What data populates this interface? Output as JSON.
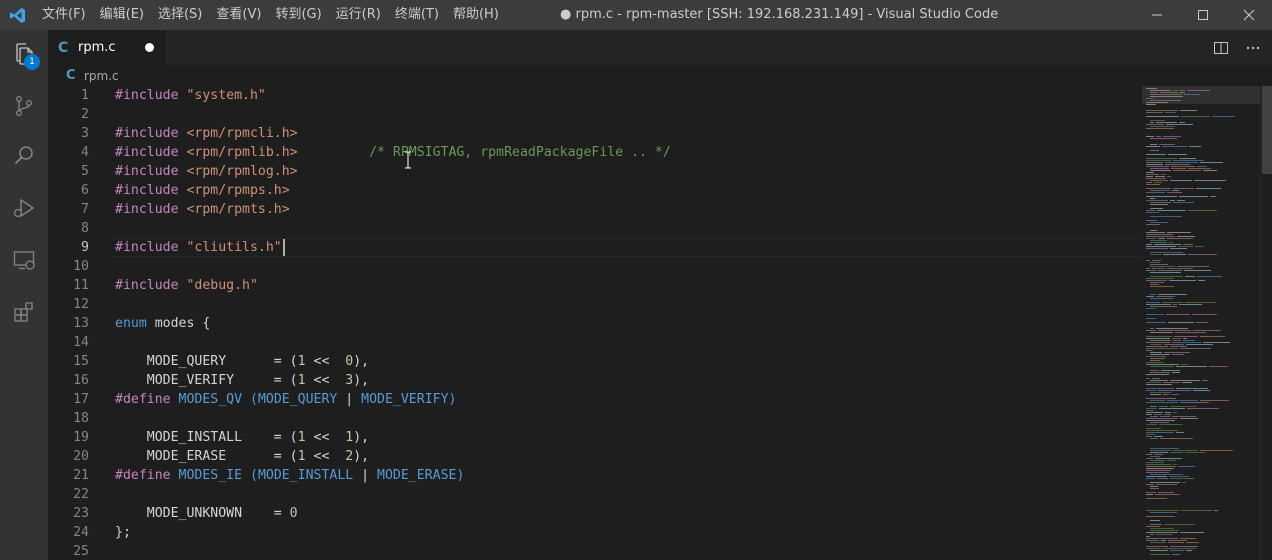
{
  "window": {
    "title": "● rpm.c - rpm-master [SSH: 192.168.231.149] - Visual Studio Code"
  },
  "menu": [
    "文件(F)",
    "编辑(E)",
    "选择(S)",
    "查看(V)",
    "转到(G)",
    "运行(R)",
    "终端(T)",
    "帮助(H)"
  ],
  "activity": {
    "explorer_badge": "1"
  },
  "tab": {
    "icon_text": "C",
    "label": "rpm.c"
  },
  "breadcrumb": {
    "icon_text": "C",
    "label": "rpm.c"
  },
  "editor": {
    "active_line": 9,
    "lines": [
      {
        "n": "1",
        "tokens": [
          [
            "pp",
            "#include "
          ],
          [
            "str",
            "\"system.h\""
          ]
        ]
      },
      {
        "n": "2",
        "tokens": []
      },
      {
        "n": "3",
        "tokens": [
          [
            "pp",
            "#include "
          ],
          [
            "str",
            "<rpm/rpmcli.h>"
          ]
        ]
      },
      {
        "n": "4",
        "tokens": [
          [
            "pp",
            "#include "
          ],
          [
            "str",
            "<rpm/rpmlib.h>"
          ],
          [
            "plain",
            "         "
          ],
          [
            "cmt",
            "/* RPMSIGTAG, rpmReadPackageFile .. */"
          ]
        ]
      },
      {
        "n": "5",
        "tokens": [
          [
            "pp",
            "#include "
          ],
          [
            "str",
            "<rpm/rpmlog.h>"
          ]
        ]
      },
      {
        "n": "6",
        "tokens": [
          [
            "pp",
            "#include "
          ],
          [
            "str",
            "<rpm/rpmps.h>"
          ]
        ]
      },
      {
        "n": "7",
        "tokens": [
          [
            "pp",
            "#include "
          ],
          [
            "str",
            "<rpm/rpmts.h>"
          ]
        ]
      },
      {
        "n": "8",
        "tokens": []
      },
      {
        "n": "9",
        "tokens": [
          [
            "pp",
            "#include "
          ],
          [
            "str",
            "\"cliutils.h\""
          ]
        ]
      },
      {
        "n": "10",
        "tokens": []
      },
      {
        "n": "11",
        "tokens": [
          [
            "pp",
            "#include "
          ],
          [
            "str",
            "\"debug.h\""
          ]
        ]
      },
      {
        "n": "12",
        "tokens": []
      },
      {
        "n": "13",
        "tokens": [
          [
            "kw",
            "enum"
          ],
          [
            "plain",
            " modes {"
          ]
        ]
      },
      {
        "n": "14",
        "tokens": []
      },
      {
        "n": "15",
        "tokens": [
          [
            "plain",
            "    MODE_QUERY      = ("
          ],
          [
            "num",
            "1"
          ],
          [
            "plain",
            " <<  "
          ],
          [
            "num",
            "0"
          ],
          [
            "plain",
            "),"
          ]
        ]
      },
      {
        "n": "16",
        "tokens": [
          [
            "plain",
            "    MODE_VERIFY     = ("
          ],
          [
            "num",
            "1"
          ],
          [
            "plain",
            " <<  "
          ],
          [
            "num",
            "3"
          ],
          [
            "plain",
            "),"
          ]
        ]
      },
      {
        "n": "17",
        "tokens": [
          [
            "pp",
            "#define "
          ],
          [
            "macro",
            "MODES_QV"
          ],
          [
            "macro",
            " (MODE_QUERY "
          ],
          [
            "plain",
            "|"
          ],
          [
            "macro",
            " MODE_VERIFY)"
          ]
        ]
      },
      {
        "n": "18",
        "tokens": []
      },
      {
        "n": "19",
        "tokens": [
          [
            "plain",
            "    MODE_INSTALL    = ("
          ],
          [
            "num",
            "1"
          ],
          [
            "plain",
            " <<  "
          ],
          [
            "num",
            "1"
          ],
          [
            "plain",
            "),"
          ]
        ]
      },
      {
        "n": "20",
        "tokens": [
          [
            "plain",
            "    MODE_ERASE      = ("
          ],
          [
            "num",
            "1"
          ],
          [
            "plain",
            " <<  "
          ],
          [
            "num",
            "2"
          ],
          [
            "plain",
            "),"
          ]
        ]
      },
      {
        "n": "21",
        "tokens": [
          [
            "pp",
            "#define "
          ],
          [
            "macro",
            "MODES_IE"
          ],
          [
            "macro",
            " (MODE_INSTALL "
          ],
          [
            "plain",
            "|"
          ],
          [
            "macro",
            " MODE_ERASE)"
          ]
        ]
      },
      {
        "n": "22",
        "tokens": []
      },
      {
        "n": "23",
        "tokens": [
          [
            "plain",
            "    MODE_UNKNOWN    = "
          ],
          [
            "num",
            "0"
          ]
        ]
      },
      {
        "n": "24",
        "tokens": [
          [
            "plain",
            "};"
          ]
        ]
      },
      {
        "n": "25",
        "tokens": []
      }
    ]
  },
  "colors": {
    "title_bar": "#3c3c3c",
    "activity_bar": "#333333",
    "editor_bg": "#1e1e1e",
    "accent": "#007acc",
    "preprocessor": "#c586c0",
    "string": "#ce9178",
    "comment": "#6a9955",
    "keyword": "#569cd6",
    "number": "#b5cea8"
  }
}
